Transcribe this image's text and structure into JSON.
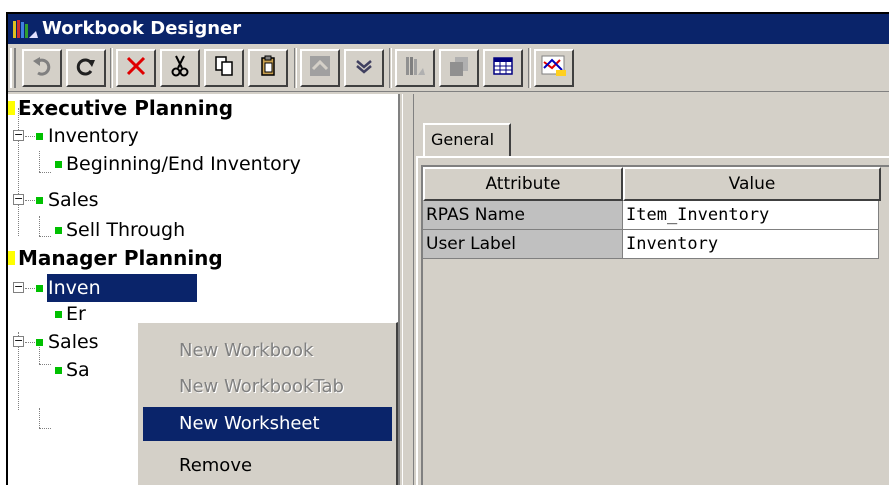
{
  "window": {
    "title": "Workbook Designer"
  },
  "toolbar": {
    "buttons": [
      {
        "icon": "undo-icon"
      },
      {
        "icon": "redo-icon"
      },
      {
        "icon": "delete-icon"
      },
      {
        "icon": "cut-icon"
      },
      {
        "icon": "copy-icon"
      },
      {
        "icon": "paste-icon"
      },
      {
        "icon": "move-up-icon"
      },
      {
        "icon": "move-down-icon"
      },
      {
        "icon": "books-icon"
      },
      {
        "icon": "tabs-icon"
      },
      {
        "icon": "grid-icon"
      },
      {
        "icon": "chart-icon"
      }
    ]
  },
  "tree": {
    "exec": {
      "label": "Executive Planning"
    },
    "exec_inventory": {
      "label": "Inventory"
    },
    "exec_beginning": {
      "label": "Beginning/End Inventory"
    },
    "exec_sales": {
      "label": "Sales"
    },
    "exec_sell": {
      "label": "Sell Through"
    },
    "mgr": {
      "label": "Manager Planning"
    },
    "mgr_inventory": {
      "label": "Inven"
    },
    "mgr_inv_child": {
      "label": "Er"
    },
    "mgr_sales": {
      "label": "Sales"
    },
    "mgr_sales_child": {
      "label": "Sa"
    }
  },
  "tabs": {
    "general": "General"
  },
  "grid": {
    "headers": {
      "attribute": "Attribute",
      "value": "Value"
    },
    "rows": [
      {
        "attribute": "RPAS Name",
        "value": "Item_Inventory"
      },
      {
        "attribute": "User Label",
        "value": "Inventory"
      }
    ]
  },
  "context_menu": {
    "items": [
      {
        "label": "New Workbook",
        "enabled": false
      },
      {
        "label": "New WorkbookTab",
        "enabled": false
      },
      {
        "label": "New Worksheet",
        "enabled": true,
        "highlighted": true
      },
      {
        "label": "Remove",
        "enabled": true
      }
    ]
  },
  "colors": {
    "titlebar": "#0a246a",
    "selection": "#0a246a",
    "folder_node": "#ffff00",
    "leaf_node": "#00c000",
    "chrome": "#d4d0c8"
  }
}
